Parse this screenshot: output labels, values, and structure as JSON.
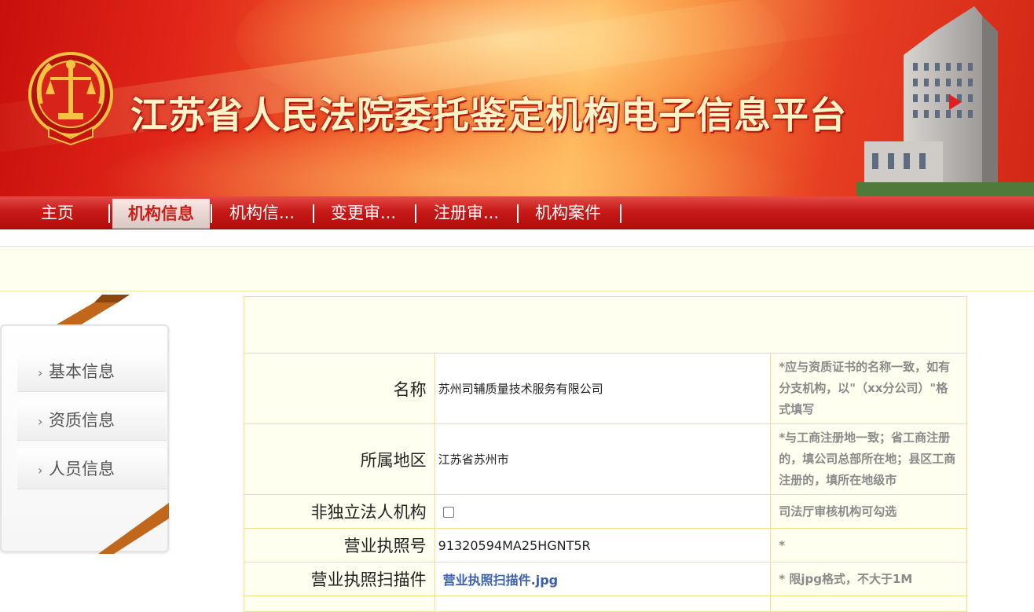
{
  "banner": {
    "title": "江苏省人民法院委托鉴定机构电子信息平台",
    "emblem_icon": "court-emblem-icon",
    "building_icon": "court-building-icon"
  },
  "nav": {
    "items": [
      {
        "label": "主页",
        "active": false
      },
      {
        "label": "机构信息",
        "active": true
      },
      {
        "label": "机构信...",
        "active": false
      },
      {
        "label": "变更审...",
        "active": false
      },
      {
        "label": "注册审...",
        "active": false
      },
      {
        "label": "机构案件",
        "active": false
      }
    ],
    "separator": "|"
  },
  "sidebar": {
    "items": [
      {
        "label": "基本信息",
        "icon": "chevron-right-icon"
      },
      {
        "label": "资质信息",
        "icon": "chevron-right-icon"
      },
      {
        "label": "人员信息",
        "icon": "chevron-right-icon"
      }
    ]
  },
  "form": {
    "rows": [
      {
        "label": "名称",
        "value": "苏州司辅质量技术服务有限公司",
        "tip": "*应与资质证书的名称一致，如有分支机构，以\"（xx分公司）\"格式填写"
      },
      {
        "label": "所属地区",
        "value": "江苏省苏州市",
        "tip": "*与工商注册地一致；省工商注册的，填公司总部所在地；县区工商注册的，填所在地级市"
      },
      {
        "label": "非独立法人机构",
        "checked": false,
        "tip": "司法厅审核机构可勾选"
      },
      {
        "label": "营业执照号",
        "value": "91320594MA25HGNT5R",
        "tip": "*"
      },
      {
        "label": "营业执照扫描件",
        "link": "营业执照扫描件.jpg",
        "tip": "* 限jpg格式，不大于1M"
      }
    ]
  },
  "colors": {
    "nav_red": "#c81a18",
    "active_text": "#c8201b",
    "table_border": "#f4e08a",
    "table_bg": "#fffff0",
    "tip_gray": "#8a8a8a",
    "link_blue": "#3a5fb0"
  }
}
